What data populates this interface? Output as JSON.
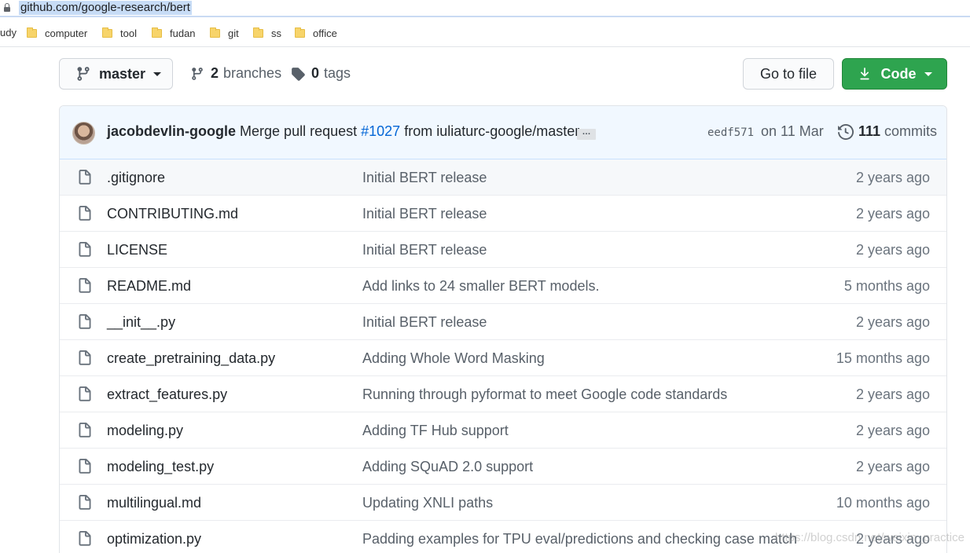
{
  "browser": {
    "url": "github.com/google-research/bert",
    "bookmarks_lead": "udy",
    "bookmarks": [
      "computer",
      "tool",
      "fudan",
      "git",
      "ss",
      "office"
    ]
  },
  "repo_nav": {
    "branch": "master",
    "branches_count": "2",
    "branches_label": "branches",
    "tags_count": "0",
    "tags_label": "tags",
    "go_to_file": "Go to file",
    "code": "Code"
  },
  "commit": {
    "author": "jacobdevlin-google",
    "message_pre": "Merge pull request",
    "pr": "#1027",
    "message_post": "from iuliaturc-google/master",
    "ellipsis": "…",
    "sha": "eedf571",
    "date": "on 11 Mar",
    "commits_count": "111",
    "commits_label": "commits"
  },
  "files": [
    {
      "name": ".gitignore",
      "message": "Initial BERT release",
      "age": "2 years ago"
    },
    {
      "name": "CONTRIBUTING.md",
      "message": "Initial BERT release",
      "age": "2 years ago"
    },
    {
      "name": "LICENSE",
      "message": "Initial BERT release",
      "age": "2 years ago"
    },
    {
      "name": "README.md",
      "message": "Add links to 24 smaller BERT models.",
      "age": "5 months ago"
    },
    {
      "name": "__init__.py",
      "message": "Initial BERT release",
      "age": "2 years ago"
    },
    {
      "name": "create_pretraining_data.py",
      "message": "Adding Whole Word Masking",
      "age": "15 months ago"
    },
    {
      "name": "extract_features.py",
      "message": "Running through pyformat to meet Google code standards",
      "age": "2 years ago"
    },
    {
      "name": "modeling.py",
      "message": "Adding TF Hub support",
      "age": "2 years ago"
    },
    {
      "name": "modeling_test.py",
      "message": "Adding SQuAD 2.0 support",
      "age": "2 years ago"
    },
    {
      "name": "multilingual.md",
      "message": "Updating XNLI paths",
      "age": "10 months ago"
    },
    {
      "name": "optimization.py",
      "message": "Padding examples for TPU eval/predictions and checking case match",
      "age": "2 years ago"
    }
  ],
  "watermark": "https://blog.csdn.net/weixin_practice",
  "colors": {
    "code_button": "#2ea44f",
    "commit_bar": "#f1f8ff",
    "link": "#0366d6"
  }
}
